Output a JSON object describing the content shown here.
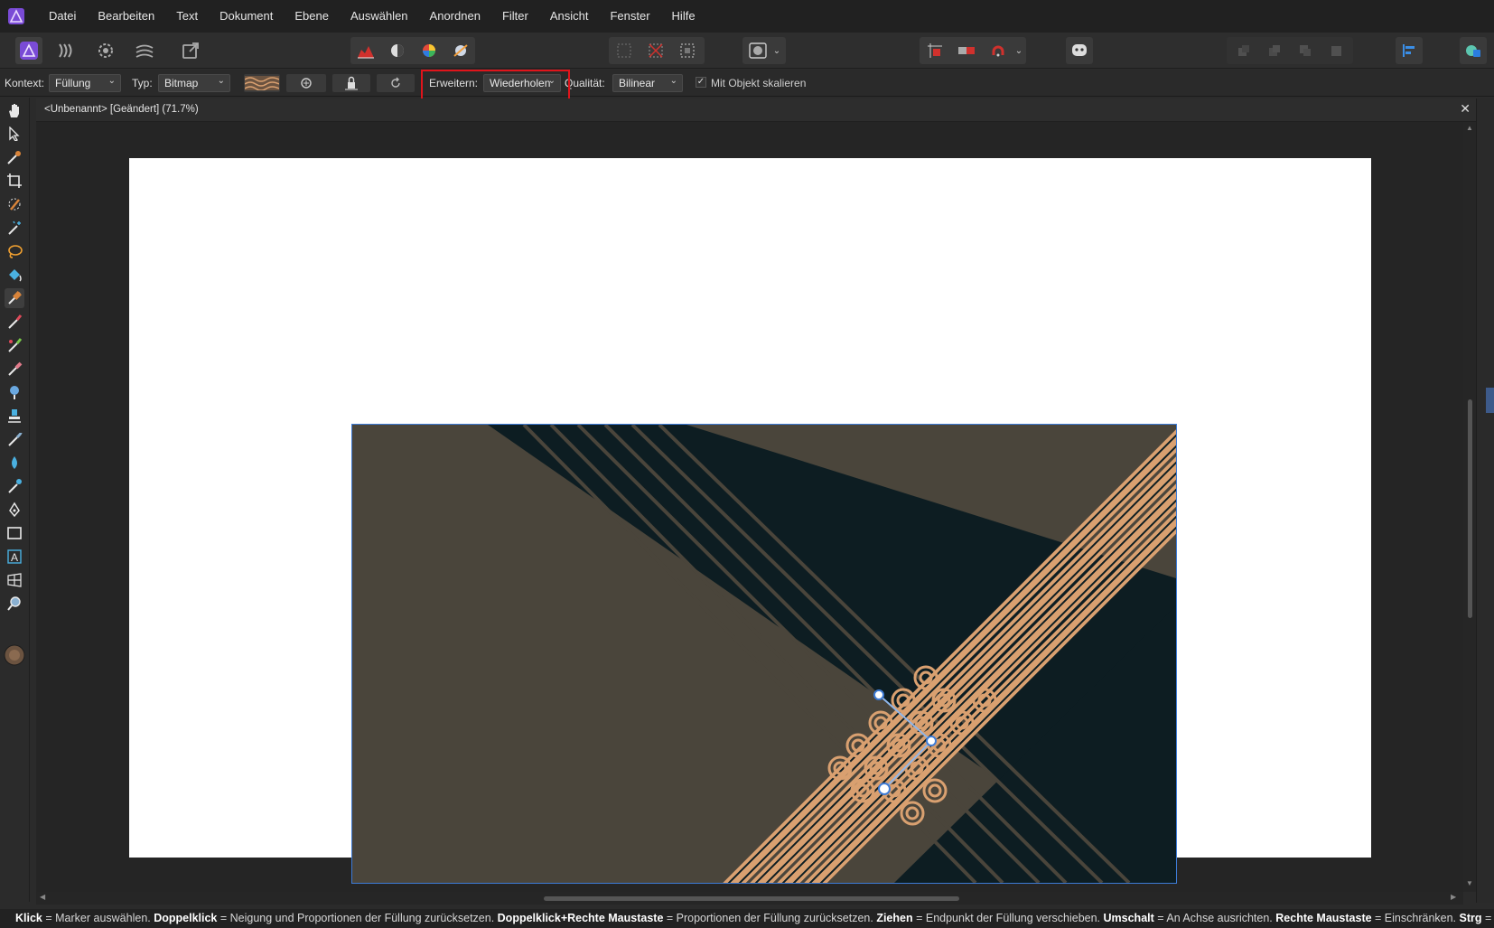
{
  "menu": [
    "Datei",
    "Bearbeiten",
    "Text",
    "Dokument",
    "Ebene",
    "Auswählen",
    "Anordnen",
    "Filter",
    "Ansicht",
    "Fenster",
    "Hilfe"
  ],
  "context": {
    "kontext_label": "Kontext:",
    "kontext_value": "Füllung",
    "typ_label": "Typ:",
    "typ_value": "Bitmap",
    "erweitern_label": "Erweitern:",
    "erweitern_value": "Wiederholen",
    "qualitaet_label": "Qualität:",
    "qualitaet_value": "Bilinear",
    "scale_label": "Mit Objekt skalieren",
    "scale_checked": true
  },
  "document": {
    "tab_title": "<Unbenannt> [Geändert] (71.7%)",
    "close_glyph": "✕"
  },
  "colors": {
    "accent": "#7a4bd6",
    "highlight": "#e0141b",
    "art_bg": "#4a453b",
    "art_dark": "#0d1d22",
    "art_copper": "#d9a070",
    "selection": "#3d7bd6"
  },
  "status": {
    "segments": [
      {
        "b": "Klick",
        "t": " = Marker auswählen. "
      },
      {
        "b": "Doppelklick",
        "t": " = Neigung und Proportionen der Füllung zurücksetzen. "
      },
      {
        "b": "Doppelklick+Rechte Maustaste",
        "t": " = Proportionen der Füllung zurücksetzen. "
      },
      {
        "b": "Ziehen",
        "t": " = Endpunkt der Füllung verschieben. "
      },
      {
        "b": "Umschalt",
        "t": " = An Achse ausrichten. "
      },
      {
        "b": "Rechte Maustaste",
        "t": " = Einschränken. "
      },
      {
        "b": "Strg",
        "t": " = Füllung versche"
      }
    ]
  }
}
